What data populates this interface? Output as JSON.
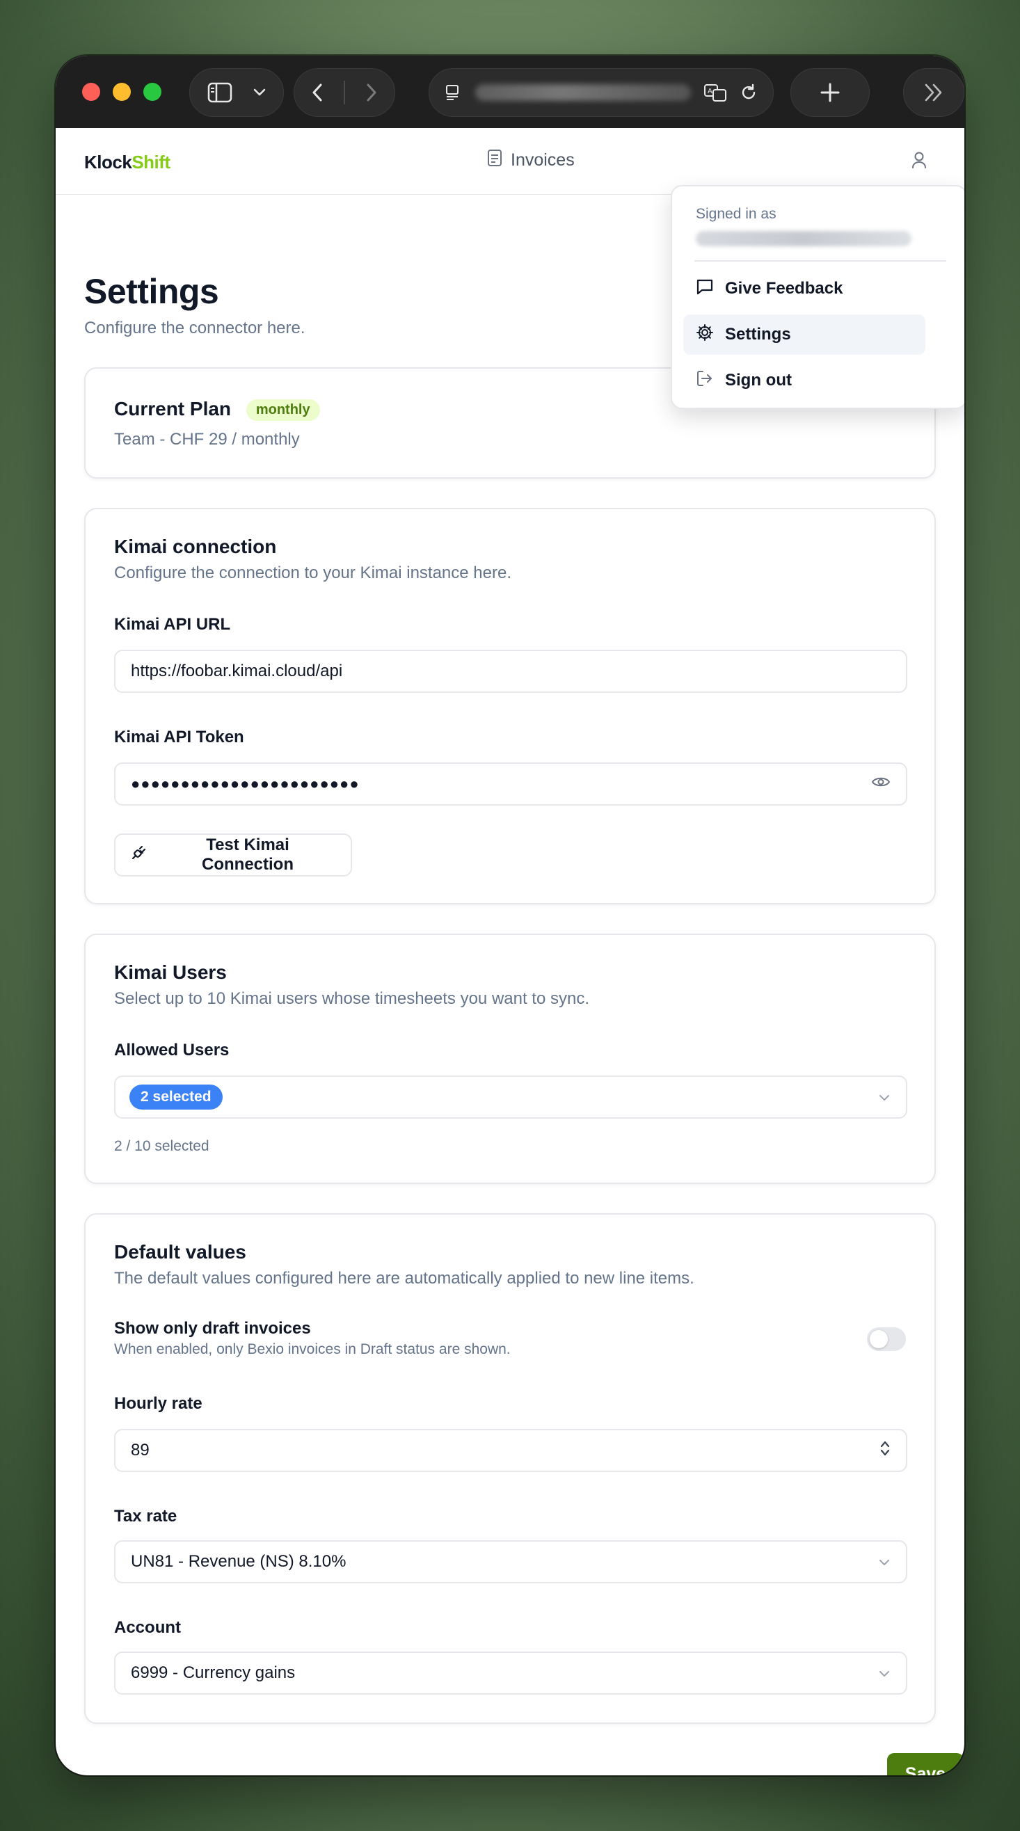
{
  "browser": {
    "url_masked": "localhost:3000/settings"
  },
  "header": {
    "logo_part1": "Klock",
    "logo_part2": "Shift",
    "nav_invoices": "Invoices"
  },
  "user_menu": {
    "signed_in_as": "Signed in as",
    "items": [
      {
        "label": "Give Feedback",
        "icon": "message-square-icon"
      },
      {
        "label": "Settings",
        "icon": "gear-icon",
        "active": true
      },
      {
        "label": "Sign out",
        "icon": "log-out-icon"
      }
    ]
  },
  "page": {
    "title": "Settings",
    "subtitle": "Configure the connector here."
  },
  "plan": {
    "title": "Current Plan",
    "badge": "monthly",
    "detail": "Team - CHF 29 / monthly"
  },
  "kimai": {
    "title": "Kimai connection",
    "description": "Configure the connection to your Kimai instance here.",
    "api_url_label": "Kimai API URL",
    "api_url_value": "https://foobar.kimai.cloud/api",
    "api_token_label": "Kimai API Token",
    "api_token_value": "●●●●●●●●●●●●●●●●●●●●●●●",
    "test_button": "Test Kimai Connection"
  },
  "users": {
    "title": "Kimai Users",
    "description": "Select up to 10 Kimai users whose timesheets you want to sync.",
    "allowed_label": "Allowed Users",
    "selected_chip": "2 selected",
    "count_text": "2 / 10 selected"
  },
  "defaults": {
    "title": "Default values",
    "description": "The default values configured here are automatically applied to new line items.",
    "draft_label": "Show only draft invoices",
    "draft_help": "When enabled, only Bexio invoices in Draft status are shown.",
    "draft_enabled": false,
    "hourly_label": "Hourly rate",
    "hourly_value": "89",
    "tax_label": "Tax rate",
    "tax_value": "UN81 - Revenue (NS) 8.10%",
    "account_label": "Account",
    "account_value": "6999 - Currency gains"
  },
  "actions": {
    "save": "Save"
  },
  "colors": {
    "brand_green": "#84cc16",
    "save_green": "#4d7c0f",
    "chip_blue": "#3b82f6"
  }
}
